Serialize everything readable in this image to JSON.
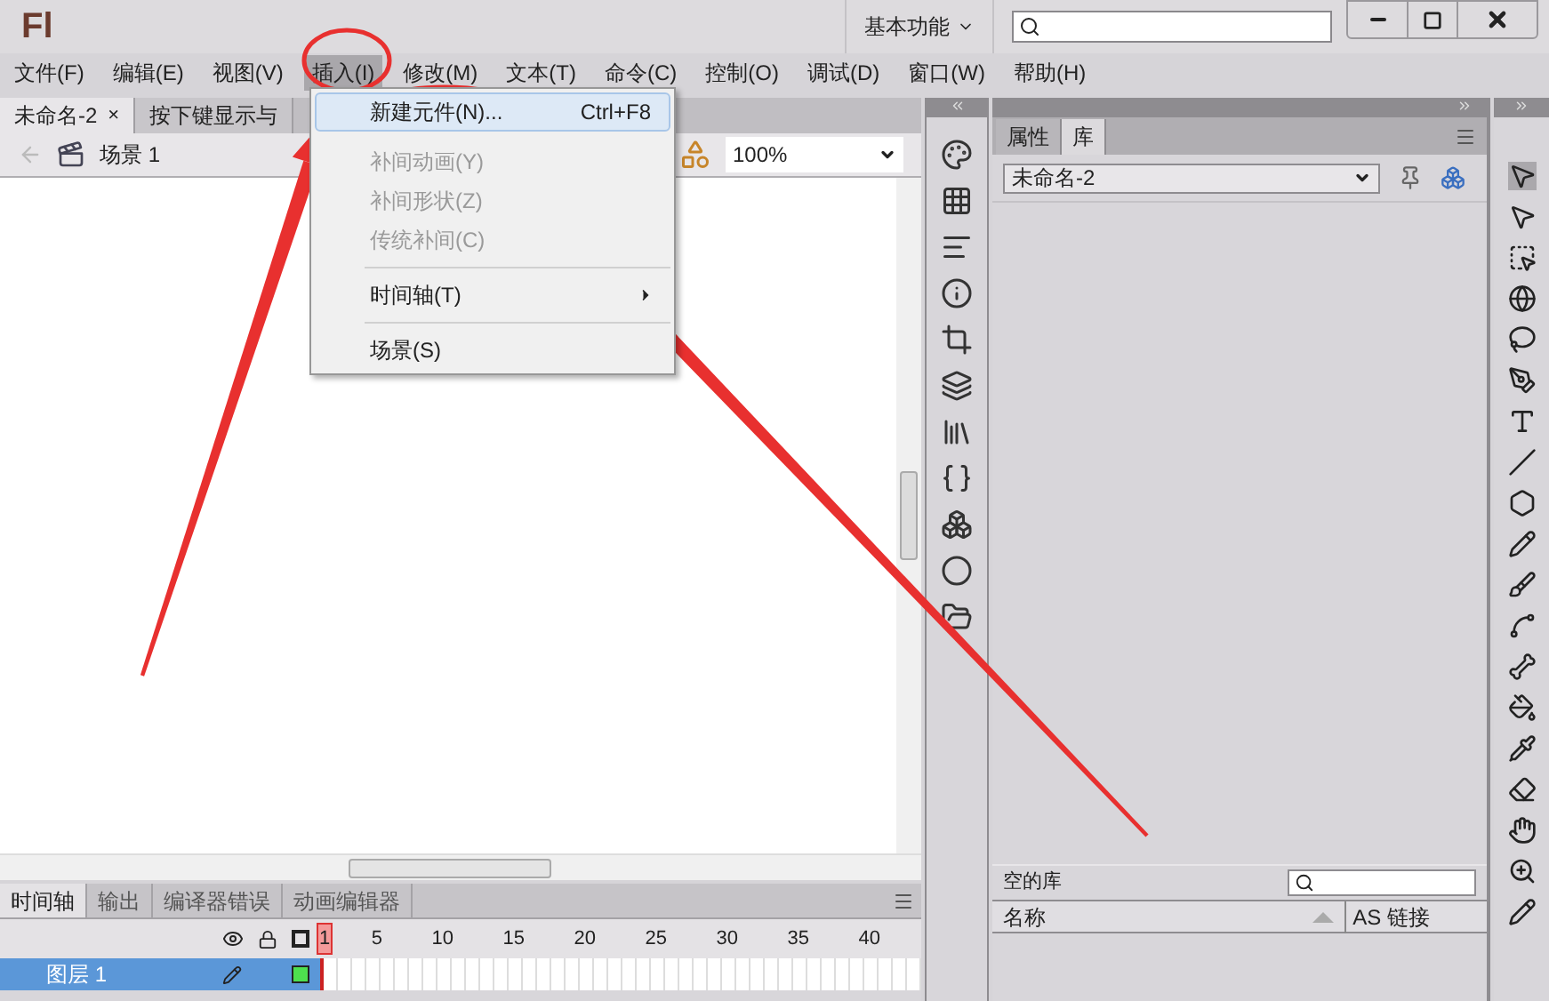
{
  "app_logo": "Fl",
  "workspace": {
    "label": "基本功能"
  },
  "menu_bar": [
    {
      "label": "文件(F)",
      "selected": false
    },
    {
      "label": "编辑(E)",
      "selected": false
    },
    {
      "label": "视图(V)",
      "selected": false
    },
    {
      "label": "插入(I)",
      "selected": true
    },
    {
      "label": "修改(M)",
      "selected": false
    },
    {
      "label": "文本(T)",
      "selected": false
    },
    {
      "label": "命令(C)",
      "selected": false
    },
    {
      "label": "控制(O)",
      "selected": false
    },
    {
      "label": "调试(D)",
      "selected": false
    },
    {
      "label": "窗口(W)",
      "selected": false
    },
    {
      "label": "帮助(H)",
      "selected": false
    }
  ],
  "document_tabs": [
    {
      "label": "未命名-2",
      "close_glyph": "×",
      "selected": true
    },
    {
      "label": "按下键显示与",
      "selected": false
    }
  ],
  "edit_bar": {
    "scene": "场景 1",
    "zoom": "100%"
  },
  "insert_menu": [
    {
      "kind": "item",
      "label": "新建元件(N)...",
      "shortcut": "Ctrl+F8",
      "highlighted": true,
      "disabled": false
    },
    {
      "kind": "item",
      "label": "补间动画(Y)",
      "highlighted": false,
      "disabled": true
    },
    {
      "kind": "item",
      "label": "补间形状(Z)",
      "highlighted": false,
      "disabled": true
    },
    {
      "kind": "item",
      "label": "传统补间(C)",
      "highlighted": false,
      "disabled": true
    },
    {
      "kind": "separator"
    },
    {
      "kind": "submenu",
      "label": "时间轴(T)",
      "highlighted": false,
      "disabled": false
    },
    {
      "kind": "separator"
    },
    {
      "kind": "item",
      "label": "场景(S)",
      "highlighted": false,
      "disabled": false
    }
  ],
  "timeline": {
    "tabs": [
      {
        "label": "时间轴",
        "selected": true
      },
      {
        "label": "输出",
        "selected": false
      },
      {
        "label": "编译器错误",
        "selected": false
      },
      {
        "label": "动画编辑器",
        "selected": false
      }
    ],
    "frame_labels": [
      "1",
      "5",
      "10",
      "15",
      "20",
      "25",
      "30",
      "35",
      "40"
    ],
    "layers": [
      {
        "name": "图层 1",
        "selected": true
      }
    ]
  },
  "library": {
    "tabs": [
      {
        "label": "属性",
        "selected": false
      },
      {
        "label": "库",
        "selected": true
      }
    ],
    "document": "未命名-2",
    "status": "空的库",
    "columns": [
      "名称",
      "AS 链接"
    ]
  }
}
